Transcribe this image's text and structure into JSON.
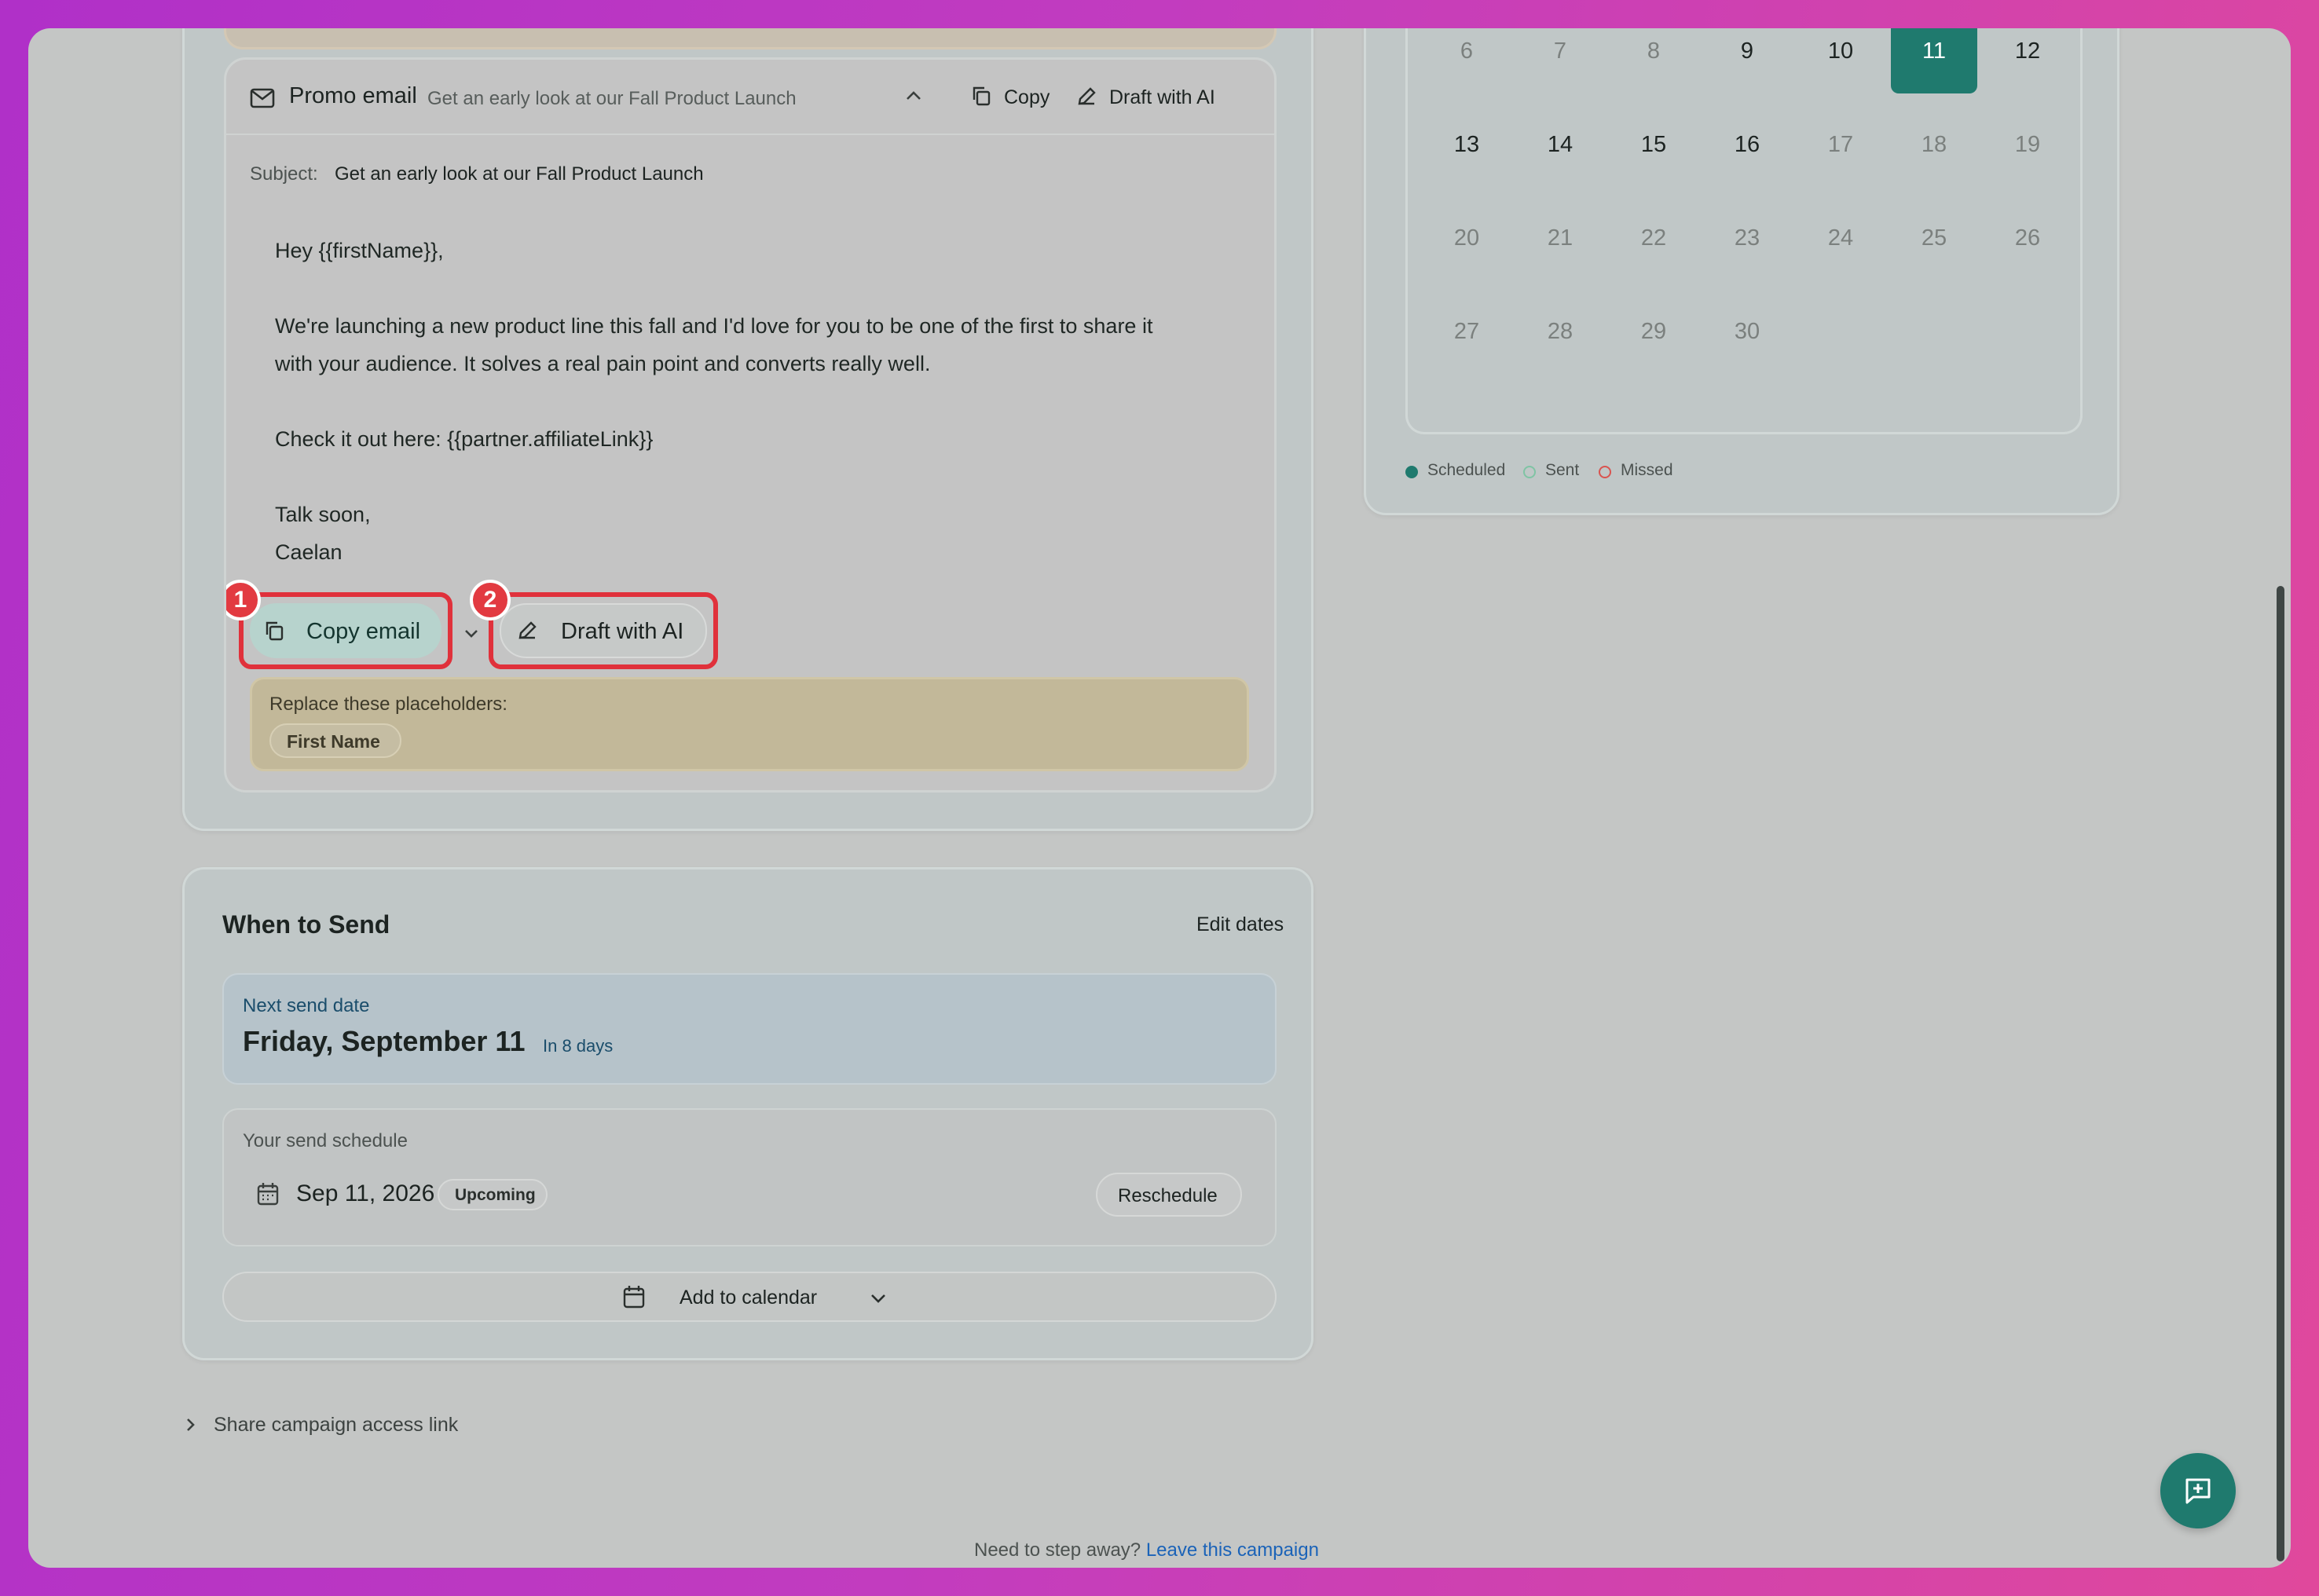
{
  "email": {
    "title": "Promo email",
    "preview": "Get an early look at our Fall Product Launch",
    "copy_label": "Copy",
    "draft_label": "Draft with AI",
    "subject_label": "Subject:",
    "subject": "Get an early look at our Fall Product Launch",
    "body": {
      "greeting": "Hey {{firstName}},",
      "para1_line1": "We're launching a new product line this fall and I'd love for you to be one of the first to share it",
      "para1_line2": "with your audience. It solves a real pain point and converts really well.",
      "para2": "Check it out here: {{partner.affiliateLink}}",
      "signoff": "Talk soon,",
      "name": "Caelan"
    },
    "copy_email_label": "Copy email",
    "draft_ai_label": "Draft with AI",
    "badge1": "1",
    "badge2": "2",
    "placeholders_title": "Replace these placeholders:",
    "placeholder_chip": "First Name"
  },
  "when": {
    "title": "When to Send",
    "edit_dates": "Edit dates",
    "next_label": "Next send date",
    "next_date": "Friday, September 11",
    "in_days": "In 8 days",
    "schedule_label": "Your send schedule",
    "schedule_date": "Sep 11, 2026",
    "upcoming": "Upcoming",
    "reschedule": "Reschedule",
    "add_calendar": "Add to calendar"
  },
  "share_link": "Share campaign access link",
  "footer": {
    "question": "Need to step away?",
    "link": "Leave this campaign"
  },
  "calendar": {
    "rows": [
      [
        "6",
        "7",
        "8",
        "9",
        "10",
        "11",
        "12"
      ],
      [
        "13",
        "14",
        "15",
        "16",
        "17",
        "18",
        "19"
      ],
      [
        "20",
        "21",
        "22",
        "23",
        "24",
        "25",
        "26"
      ],
      [
        "27",
        "28",
        "29",
        "30",
        "",
        "",
        ""
      ]
    ],
    "selected": "11",
    "bold_days": [
      "9",
      "10",
      "12",
      "13",
      "14",
      "15",
      "16"
    ],
    "legend": [
      "Scheduled",
      "Sent",
      "Missed"
    ]
  },
  "colors": {
    "accent": "#1f8a7d",
    "highlight": "#e0313b",
    "link": "#1b63b8"
  }
}
